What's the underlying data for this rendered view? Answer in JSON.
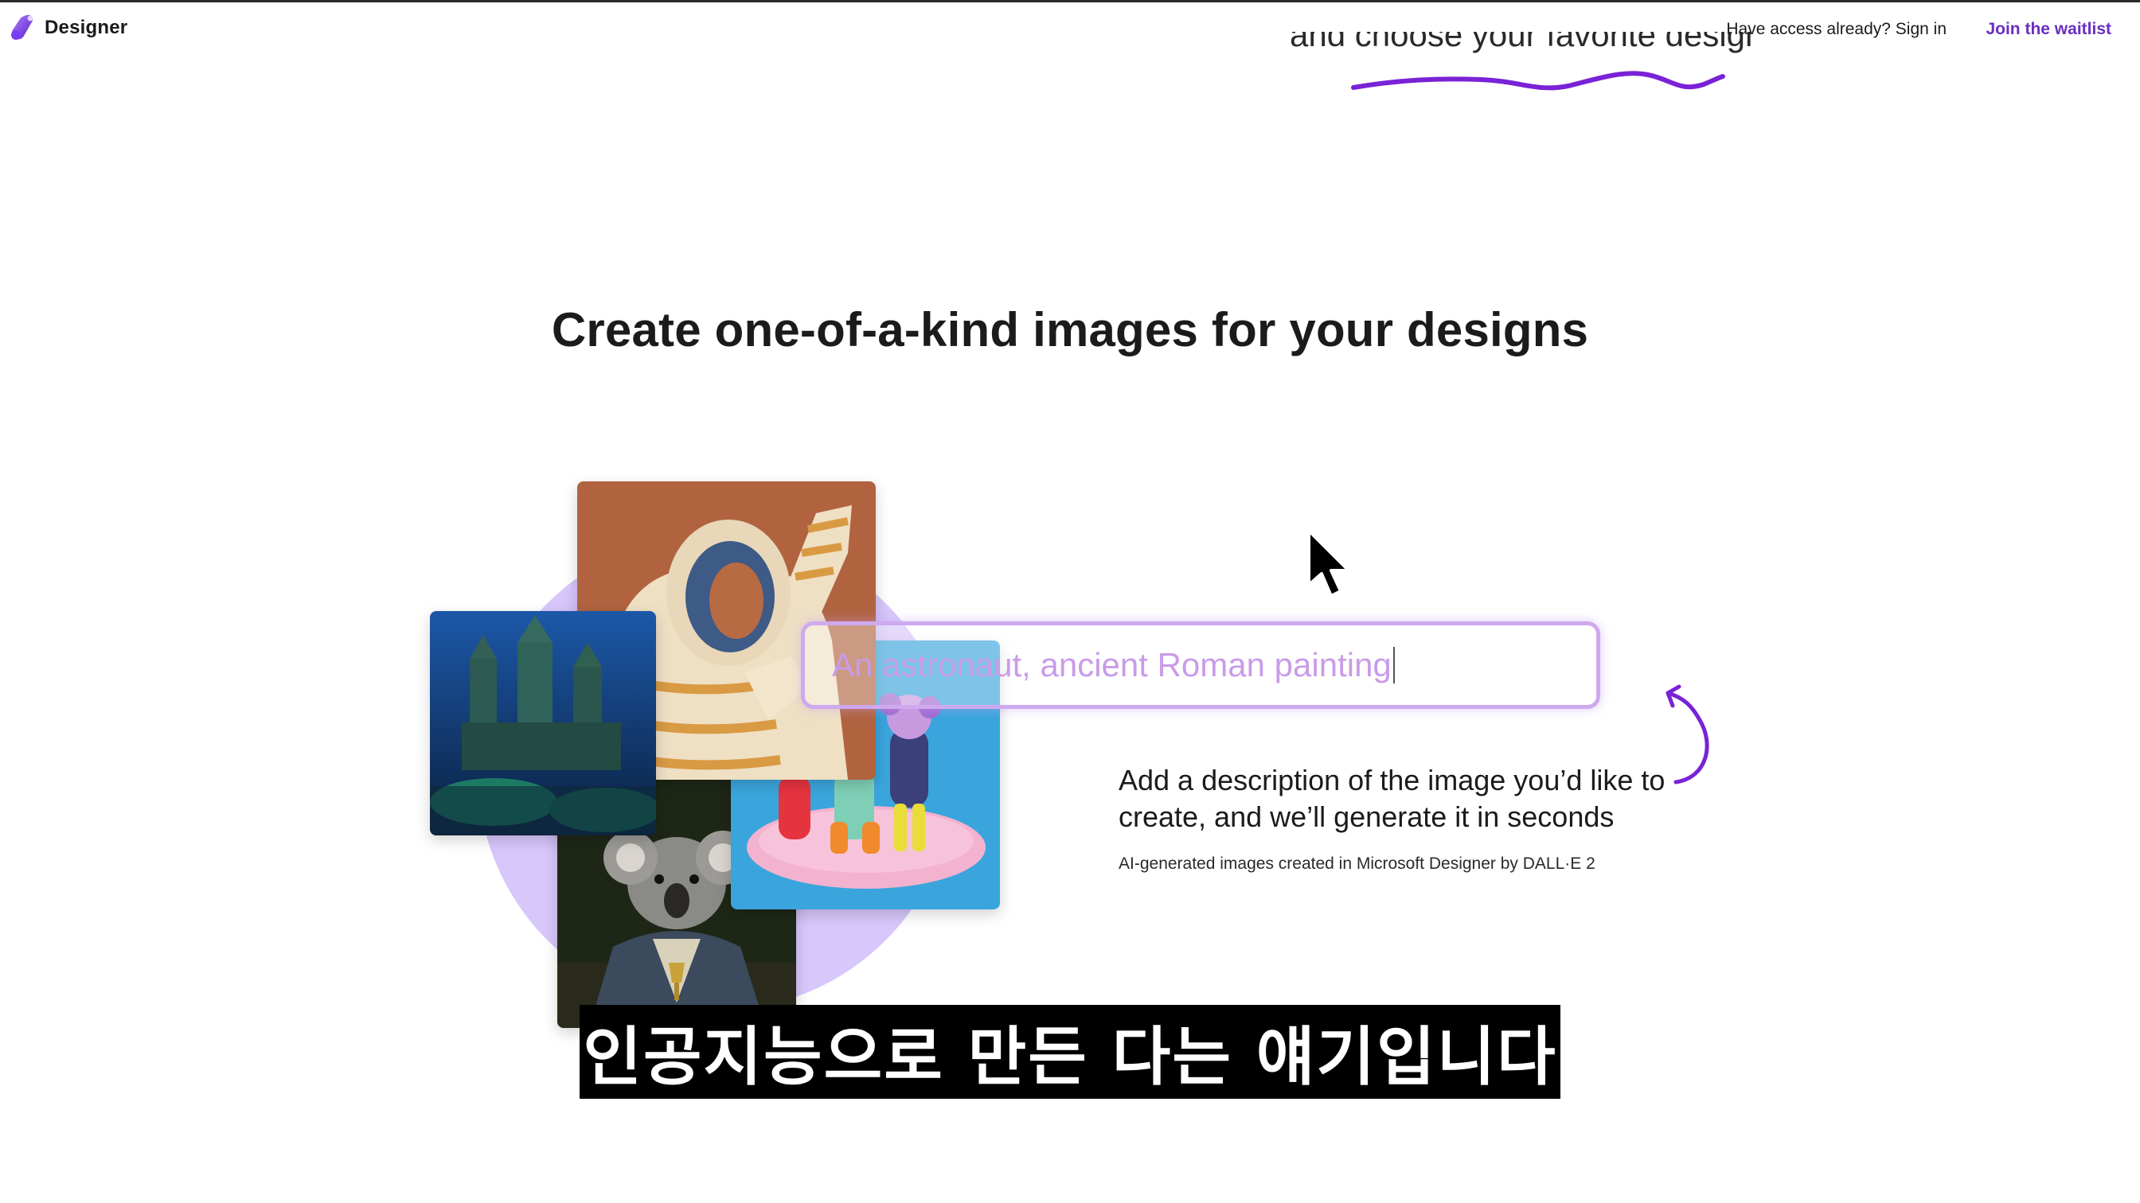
{
  "header": {
    "brand_name": "Designer",
    "brand_icon": "designer-logo-icon",
    "signin_label": "Have access already? Sign in",
    "waitlist_label": "Join the waitlist",
    "accent_color": "#6a2ec2"
  },
  "previous_section": {
    "caption_partial": "and choose your favorite design"
  },
  "main": {
    "heading": "Create one-of-a-kind images for your designs",
    "prompt_text": "An astronaut, ancient Roman painting",
    "description": "Add a description of the image you’d like to create, and we’ll generate it in seconds",
    "credit": "AI-generated images created in Microsoft Designer by DALL·E 2",
    "circle_color": "#d8c7fb",
    "prompt_border_color": "#cfa9ef"
  },
  "collage": {
    "images": [
      "astronaut-painting",
      "underwater-castle",
      "clay-figures",
      "koala-in-robe"
    ]
  },
  "subtitle": {
    "text": "인공지능으로 만든 다는 얘기입니다"
  }
}
